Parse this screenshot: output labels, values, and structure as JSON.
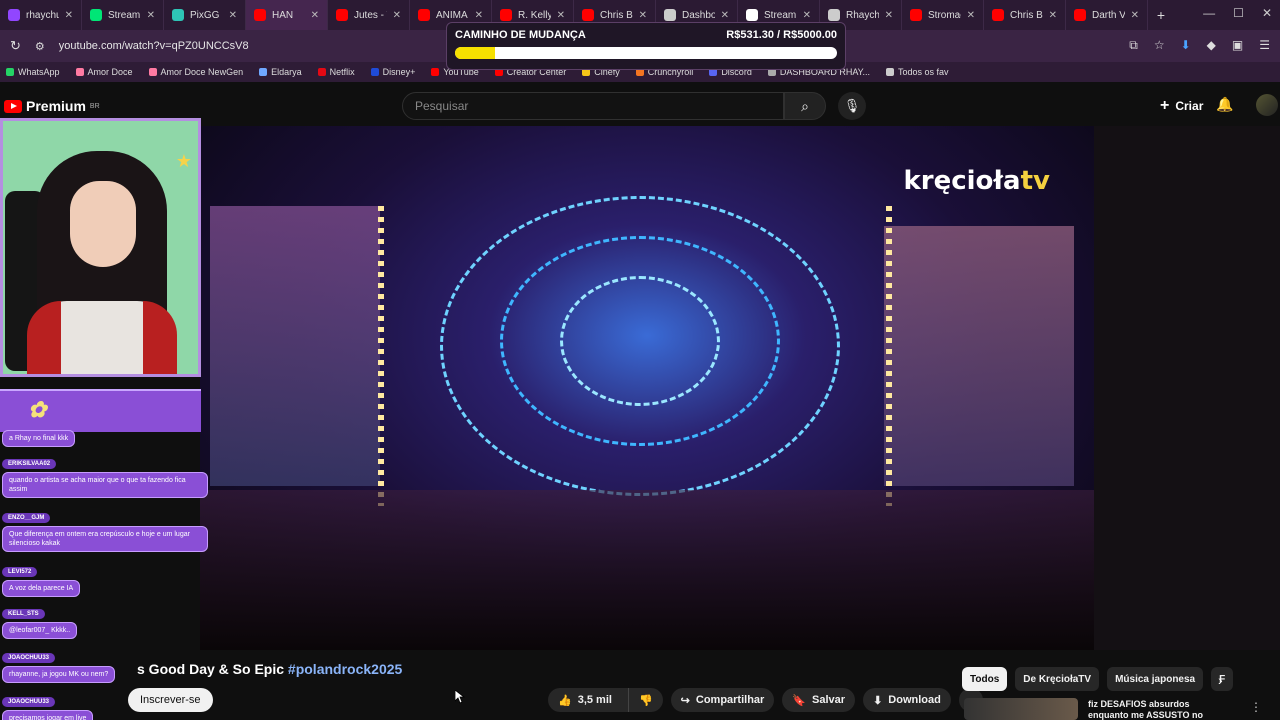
{
  "browser": {
    "tabs": [
      {
        "label": "rhaychu",
        "color": "#9146ff"
      },
      {
        "label": "Stream",
        "color": "#00e676"
      },
      {
        "label": "PixGG",
        "color": "#2ec4b6"
      },
      {
        "label": "HAN",
        "color": "#ff0000",
        "active": true
      },
      {
        "label": "Jutes - T",
        "color": "#ff0000"
      },
      {
        "label": "ANIMA",
        "color": "#ff0000"
      },
      {
        "label": "R. Kelly",
        "color": "#ff0000"
      },
      {
        "label": "Chris Br",
        "color": "#ff0000"
      },
      {
        "label": "Dashbo",
        "color": "#cccccc"
      },
      {
        "label": "StreamE",
        "color": "#ffffff"
      },
      {
        "label": "Rhaych",
        "color": "#cccccc"
      },
      {
        "label": "Stromae",
        "color": "#ff0000"
      },
      {
        "label": "Chris Br",
        "color": "#ff0000"
      },
      {
        "label": "Darth V",
        "color": "#ff0000"
      }
    ],
    "url": "youtube.com/watch?v=qPZ0UNCCsV8",
    "bookmarks": [
      {
        "label": "WhatsApp",
        "color": "#25d366"
      },
      {
        "label": "Amor Doce",
        "color": "#ff7aa2"
      },
      {
        "label": "Amor Doce NewGen",
        "color": "#ff7aa2"
      },
      {
        "label": "Eldarya",
        "color": "#6fa8ff"
      },
      {
        "label": "Netflix",
        "color": "#e50914"
      },
      {
        "label": "Disney+",
        "color": "#1f4bd8"
      },
      {
        "label": "YouTube",
        "color": "#ff0000"
      },
      {
        "label": "Creator Center",
        "color": "#ff0000"
      },
      {
        "label": "Cinefy",
        "color": "#f5c518"
      },
      {
        "label": "Crunchyroll",
        "color": "#f47521"
      },
      {
        "label": "Discord",
        "color": "#5865f2"
      },
      {
        "label": "DASHBOARD RHAY...",
        "color": "#aaaaaa"
      },
      {
        "label": "Todos os fav",
        "color": "#cccccc"
      }
    ]
  },
  "goal": {
    "title": "CAMINHO DE MUDANÇA",
    "amount": "R$531.30 / R$5000.00",
    "progress": 0.106
  },
  "youtube": {
    "logo": "Premium",
    "region": "BR",
    "search_placeholder": "Pesquisar",
    "create_label": "Criar",
    "watermark_a": "kręcioła",
    "watermark_b": "tv",
    "video_title": "s Good Day & So Epic",
    "video_hashtag": "#polandrock2025",
    "subscribe_label": "Inscrever-se",
    "like_count": "3,5 mil",
    "share_label": "Compartilhar",
    "save_label": "Salvar",
    "download_label": "Download",
    "chips": [
      "Todos",
      "De KręciołaTV",
      "Música japonesa",
      "F"
    ],
    "rec_title": "fiz DESAFIOS absurdos enquanto me ASSUSTO no"
  },
  "chat": [
    {
      "user": "",
      "text": "a Rhay no final kkk"
    },
    {
      "user": "ERIKSILVAA02",
      "text": "quando o artista se acha maior que o que ta fazendo fica assim"
    },
    {
      "user": "ENZO__GJM",
      "text": "Que diferença em ontem era crepúsculo e hoje e um lugar silencioso kakak"
    },
    {
      "user": "LEVI572",
      "text": "A voz dela parece IA"
    },
    {
      "user": "KELL_STS",
      "text": "@leofar007_ Kkkk.."
    },
    {
      "user": "JOAOCHUU33",
      "text": "rhayanne, ja jogou MK ou nem?"
    },
    {
      "user": "JOAOCHUU33",
      "text": "precisamos jogar em live"
    }
  ]
}
